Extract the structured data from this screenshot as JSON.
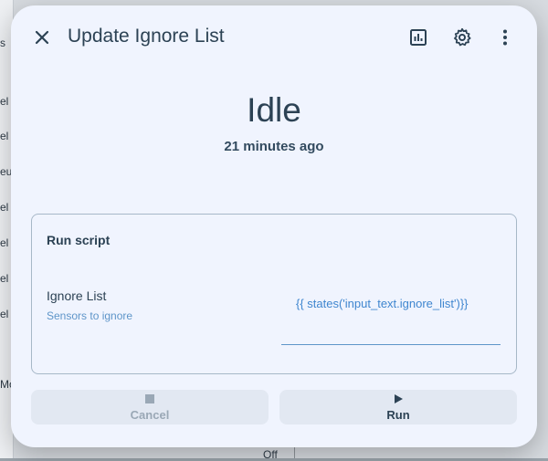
{
  "background": {
    "items": [
      "s",
      "el",
      "el",
      "eu",
      "el",
      "el",
      "el",
      "el",
      "Mo"
    ],
    "off_label": "Off"
  },
  "dialog": {
    "title": "Update Ignore List",
    "state": "Idle",
    "last_changed": "21 minutes ago",
    "card": {
      "title": "Run script",
      "field": {
        "label": "Ignore List",
        "description": "Sensors to ignore",
        "value": "{{ states('input_text.ignore_list')}}"
      }
    },
    "actions": {
      "cancel_label": "Cancel",
      "run_label": "Run"
    }
  },
  "icons": {
    "close": "close-icon",
    "history": "history-chart-icon",
    "settings": "gear-icon",
    "menu": "dots-vertical-icon",
    "cancel": "stop-icon",
    "run": "play-icon"
  },
  "colors": {
    "dialog_bg": "#f0f4fe",
    "text": "#2c4254",
    "accent": "#3f86cf",
    "card_border": "#a7b8c8"
  }
}
